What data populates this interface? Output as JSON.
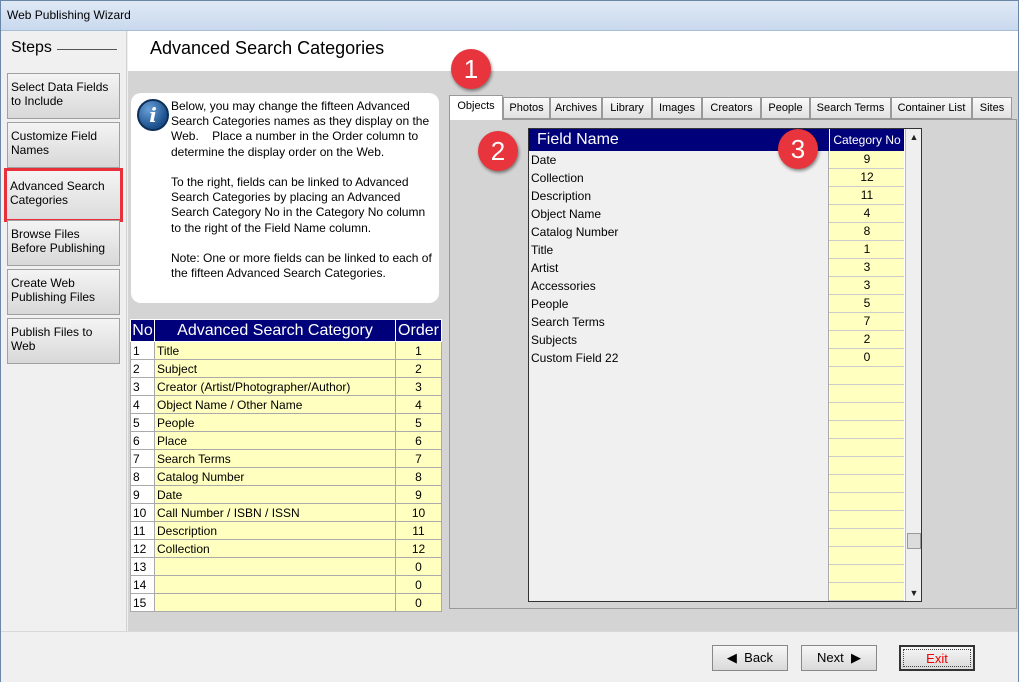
{
  "window": {
    "title": "Web Publishing Wizard"
  },
  "sidebar": {
    "title": "Steps",
    "steps": [
      {
        "label": "Select Data Fields to Include"
      },
      {
        "label": "Customize Field Names"
      },
      {
        "label": "Advanced Search Categories",
        "active": true
      },
      {
        "label": "Browse Files Before Publishing"
      },
      {
        "label": "Create Web Publishing Files"
      },
      {
        "label": "Publish Files to Web"
      }
    ]
  },
  "header": {
    "title": "Advanced Search Categories"
  },
  "info": {
    "icon": "info-icon",
    "text": "Below, you may change the fifteen Advanced Search Categories names as they display on the Web.    Place a number in the Order column to determine the display order on the Web.\n\nTo the right, fields can be linked to Advanced Search Categories by placing an Advanced Search Category No in the Category No column to the right of the Field Name column.\n\nNote: One or more fields can be linked to each of the fifteen Advanced Search Categories."
  },
  "left_table": {
    "headers": [
      "No",
      "Advanced Search Category",
      "Order"
    ],
    "rows": [
      [
        "1",
        "Title",
        "1"
      ],
      [
        "2",
        "Subject",
        "2"
      ],
      [
        "3",
        "Creator (Artist/Photographer/Author)",
        "3"
      ],
      [
        "4",
        "Object Name / Other Name",
        "4"
      ],
      [
        "5",
        "People",
        "5"
      ],
      [
        "6",
        "Place",
        "6"
      ],
      [
        "7",
        "Search Terms",
        "7"
      ],
      [
        "8",
        "Catalog Number",
        "8"
      ],
      [
        "9",
        "Date",
        "9"
      ],
      [
        "10",
        "Call Number / ISBN / ISSN",
        "10"
      ],
      [
        "11",
        "Description",
        "11"
      ],
      [
        "12",
        "Collection",
        "12"
      ],
      [
        "13",
        "",
        "0"
      ],
      [
        "14",
        "",
        "0"
      ],
      [
        "15",
        "",
        "0"
      ]
    ]
  },
  "tabs": [
    "Objects",
    "Photos",
    "Archives",
    "Library",
    "Images",
    "Creators",
    "People",
    "Search Terms",
    "Container List",
    "Sites"
  ],
  "active_tab": "Objects",
  "right_table": {
    "headers": [
      "Field Name",
      "Category No"
    ],
    "rows": [
      [
        "Date",
        "9"
      ],
      [
        "Collection",
        "12"
      ],
      [
        "Description",
        "11"
      ],
      [
        "Object Name",
        "4"
      ],
      [
        "Catalog Number",
        "8"
      ],
      [
        "Title",
        "1"
      ],
      [
        "Artist",
        "3"
      ],
      [
        "Accessories",
        "3"
      ],
      [
        "People",
        "5"
      ],
      [
        "Search Terms",
        "7"
      ],
      [
        "Subjects",
        "2"
      ],
      [
        "Custom Field 22",
        "0"
      ]
    ]
  },
  "callouts": [
    "1",
    "2",
    "3"
  ],
  "colors": {
    "header_blue": "#00007a",
    "cell_yellow": "#ffffc0",
    "callout_red": "#e8343c",
    "active_border": "#e8303a"
  },
  "footer": {
    "back": "Back",
    "next": "Next",
    "exit": "Exit"
  }
}
